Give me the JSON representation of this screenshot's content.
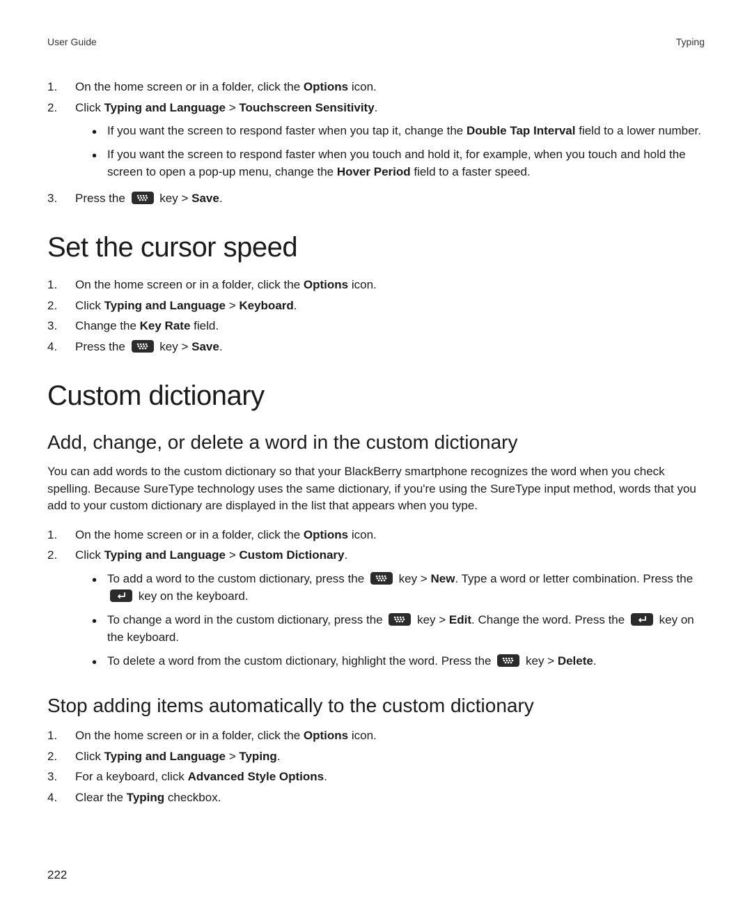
{
  "header": {
    "left": "User Guide",
    "right": "Typing"
  },
  "page_number": "222",
  "section_a": {
    "steps": [
      {
        "num": "1.",
        "pre": "On the home screen or in a folder, click the ",
        "b1": "Options",
        "post": " icon."
      },
      {
        "num": "2.",
        "pre": "Click ",
        "b1": "Typing and Language",
        "mid": " > ",
        "b2": "Touchscreen Sensitivity",
        "post": "."
      }
    ],
    "bullets": [
      {
        "pre": "If you want the screen to respond faster when you tap it, change the ",
        "b1": "Double Tap Interval",
        "post": " field to a lower number."
      },
      {
        "pre": "If you want the screen to respond faster when you touch and hold it, for example, when you touch and hold the screen to open a pop-up menu, change the ",
        "b1": "Hover Period",
        "post": " field to a faster speed."
      }
    ],
    "step3": {
      "num": "3.",
      "pre": "Press the ",
      "mid": " key > ",
      "b1": "Save",
      "post": "."
    }
  },
  "section_b": {
    "title": "Set the cursor speed",
    "steps": [
      {
        "num": "1.",
        "pre": "On the home screen or in a folder, click the ",
        "b1": "Options",
        "post": " icon."
      },
      {
        "num": "2.",
        "pre": "Click ",
        "b1": "Typing and Language",
        "mid": " > ",
        "b2": "Keyboard",
        "post": "."
      },
      {
        "num": "3.",
        "pre": "Change the ",
        "b1": "Key Rate",
        "post": " field."
      }
    ],
    "step4": {
      "num": "4.",
      "pre": "Press the ",
      "mid": " key > ",
      "b1": "Save",
      "post": "."
    }
  },
  "section_c": {
    "title": "Custom dictionary",
    "sub1": {
      "title": "Add, change, or delete a word in the custom dictionary",
      "intro": "You can add words to the custom dictionary so that your BlackBerry smartphone recognizes the word when you check spelling. Because SureType technology uses the same dictionary, if you're using the SureType input method, words that you add to your custom dictionary are displayed in the list that appears when you type.",
      "steps": [
        {
          "num": "1.",
          "pre": "On the home screen or in a folder, click the ",
          "b1": "Options",
          "post": " icon."
        },
        {
          "num": "2.",
          "pre": "Click ",
          "b1": "Typing and Language",
          "mid": " > ",
          "b2": "Custom Dictionary",
          "post": "."
        }
      ],
      "bullets": {
        "b1": {
          "pre": "To add a word to the custom dictionary, press the ",
          "mid1": " key > ",
          "bold1": "New",
          "mid2": ". Type a word or letter combination. Press the ",
          "post": " key on the keyboard."
        },
        "b2": {
          "pre": "To change a word in the custom dictionary, press the ",
          "mid1": " key > ",
          "bold1": "Edit",
          "mid2": ". Change the word. Press the ",
          "post": " key on the keyboard."
        },
        "b3": {
          "pre": "To delete a word from the custom dictionary, highlight the word. Press the ",
          "mid1": " key > ",
          "bold1": "Delete",
          "post": "."
        }
      }
    },
    "sub2": {
      "title": "Stop adding items automatically to the custom dictionary",
      "steps": [
        {
          "num": "1.",
          "pre": "On the home screen or in a folder, click the ",
          "b1": "Options",
          "post": " icon."
        },
        {
          "num": "2.",
          "pre": "Click ",
          "b1": "Typing and Language",
          "mid": " > ",
          "b2": "Typing",
          "post": "."
        },
        {
          "num": "3.",
          "pre": "For a keyboard, click ",
          "b1": "Advanced Style Options",
          "post": "."
        },
        {
          "num": "4.",
          "pre": "Clear the ",
          "b1": "Typing",
          "post": " checkbox."
        }
      ]
    }
  }
}
